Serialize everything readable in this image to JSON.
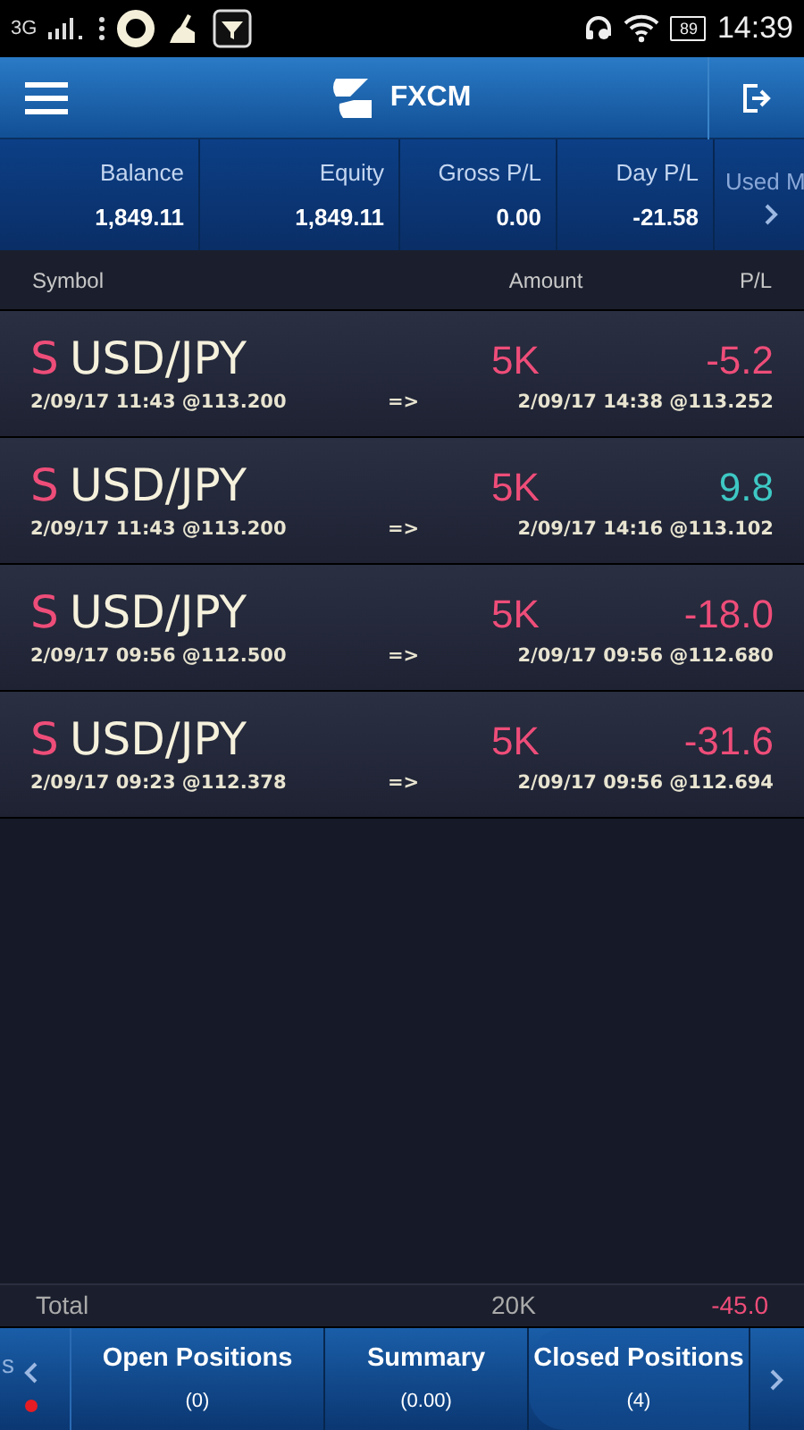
{
  "status_bar": {
    "network": "3G",
    "battery": "89",
    "time": "14:39"
  },
  "header": {
    "title": "FXCM"
  },
  "summary": [
    {
      "label": "Balance",
      "value": "1,849.11"
    },
    {
      "label": "Equity",
      "value": "1,849.11"
    },
    {
      "label": "Gross P/L",
      "value": "0.00"
    },
    {
      "label": "Day P/L",
      "value": "-21.58"
    },
    {
      "label": "Used M"
    }
  ],
  "table": {
    "columns": [
      "Symbol",
      "Amount",
      "P/L"
    ],
    "rows": [
      {
        "side": "S",
        "symbol": "USD/JPY",
        "amount": "5K",
        "pl": "-5.2",
        "color": "#ee4d79",
        "open": "2/09/17 11:43 @113.200",
        "arrow": "=>",
        "close": "2/09/17 14:38 @113.252"
      },
      {
        "side": "S",
        "symbol": "USD/JPY",
        "amount": "5K",
        "pl": "9.8",
        "color": "#3ec8c4",
        "open": "2/09/17 11:43 @113.200",
        "arrow": "=>",
        "close": "2/09/17 14:16 @113.102"
      },
      {
        "side": "S",
        "symbol": "USD/JPY",
        "amount": "5K",
        "pl": "-18.0",
        "color": "#ee4d79",
        "open": "2/09/17 09:56 @112.500",
        "arrow": "=>",
        "close": "2/09/17 09:56 @112.680"
      },
      {
        "side": "S",
        "symbol": "USD/JPY",
        "amount": "5K",
        "pl": "-31.6",
        "color": "#ee4d79",
        "open": "2/09/17 09:23 @112.378",
        "arrow": "=>",
        "close": "2/09/17 09:56 @112.694"
      }
    ],
    "total": {
      "label": "Total",
      "amount": "20K",
      "pl": "-45.0",
      "color": "#ee4d79"
    }
  },
  "tabs": {
    "left_edge": "s",
    "items": [
      {
        "label": "Open Positions",
        "count": "(0)",
        "selected": false
      },
      {
        "label": "Summary",
        "count": "(0.00)",
        "selected": false
      },
      {
        "label": "Closed Positions",
        "count": "(4)",
        "selected": true
      }
    ]
  }
}
